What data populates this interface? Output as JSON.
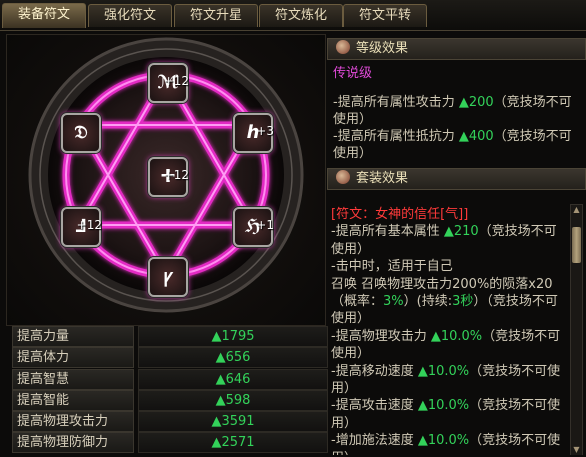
{
  "tabs": [
    {
      "label": "装备符文",
      "active": true
    },
    {
      "label": "强化符文",
      "active": false
    },
    {
      "label": "符文升星",
      "active": false
    },
    {
      "label": "符文炼化",
      "active": false
    },
    {
      "label": "符文平转",
      "active": false
    }
  ],
  "runes": [
    {
      "glyph": "ℳ",
      "level": "+12"
    },
    {
      "glyph": "ℎ",
      "level": "+3"
    },
    {
      "glyph": "ℌ",
      "level": "+1"
    },
    {
      "glyph": "ꝩ",
      "level": ""
    },
    {
      "glyph": "⅃",
      "level": "+12"
    },
    {
      "glyph": "𝔇",
      "level": ""
    },
    {
      "glyph": "ⵜ",
      "level": "+12"
    }
  ],
  "stats": [
    {
      "label": "提高力量",
      "value": "▲1795"
    },
    {
      "label": "提高体力",
      "value": "▲656"
    },
    {
      "label": "提高智慧",
      "value": "▲646"
    },
    {
      "label": "提高智能",
      "value": "▲598"
    },
    {
      "label": "提高物理攻击力",
      "value": "▲3591"
    },
    {
      "label": "提高物理防御力",
      "value": "▲2571"
    }
  ],
  "level_effect": {
    "title": "等级效果",
    "tier": "传说级",
    "lines": [
      {
        "text": "-提高所有属性攻击力 ",
        "value": "▲200",
        "note": "（竞技场不可使用）"
      },
      {
        "text": "-提高所有属性抵抗力 ",
        "value": "▲400",
        "note": "（竞技场不可使用）"
      }
    ]
  },
  "set_effect": {
    "title": "套装效果",
    "name": "[符文：女神的信任[气]]",
    "l1": "-提高所有基本属性 ",
    "l1v": "▲210",
    "l1n": "（竞技场不可使用）",
    "l2": "-击中时，适用于自己",
    "l3a": "召唤 召唤物理攻击力200%的陨落x20（概率：",
    "l3b": "3%",
    "l3c": "）(持续:",
    "l3d": "3秒",
    "l3e": "）（竞技场不可使用）",
    "l4": "-提高物理攻击力 ",
    "l4v": "▲10.0%",
    "l4n": "（竞技场不可使用）",
    "l5": "-提高移动速度 ",
    "l5v": "▲10.0%",
    "l5n": "（竞技场不可使用）",
    "l6": "-提高攻击速度 ",
    "l6v": "▲10.0%",
    "l6n": "（竞技场不可使用）",
    "l7": "-增加施法速度 ",
    "l7v": "▲10.0%",
    "l7n": "（竞技场不可使用）"
  }
}
